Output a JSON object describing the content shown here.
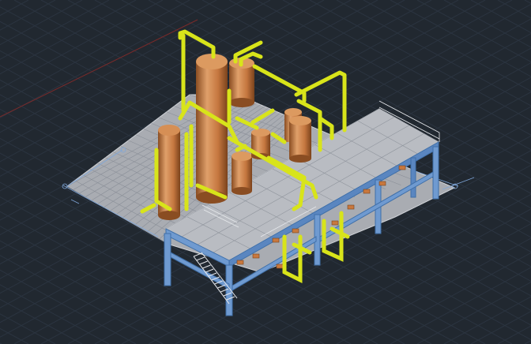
{
  "viewport": {
    "type": "cad-3d-model-viewport",
    "background_color": "#212830",
    "grid_color": "#2b3440",
    "axis_color": "#7a2a2a",
    "colors": {
      "vessel_light": "#e0a06a",
      "vessel_mid": "#c5773f",
      "vessel_dark": "#8a4d22",
      "pipe": "#d8e41a",
      "pipe_dark": "#9aa30f",
      "steel": "#6f9ad0",
      "steel_dark": "#3f6fa8",
      "deck": "#b9bcc2",
      "deck_grid": "#8a8f98",
      "railing": "#e6e8ec",
      "valve": "#c8783e",
      "dimension_line": "#7fa6d9"
    },
    "vessels": [
      "tall-column-left",
      "tall-column-center",
      "top-drum",
      "small-drum-center",
      "small-drum-right-upper",
      "small-drum-right",
      "small-drum-center-low"
    ],
    "text_labels": []
  }
}
